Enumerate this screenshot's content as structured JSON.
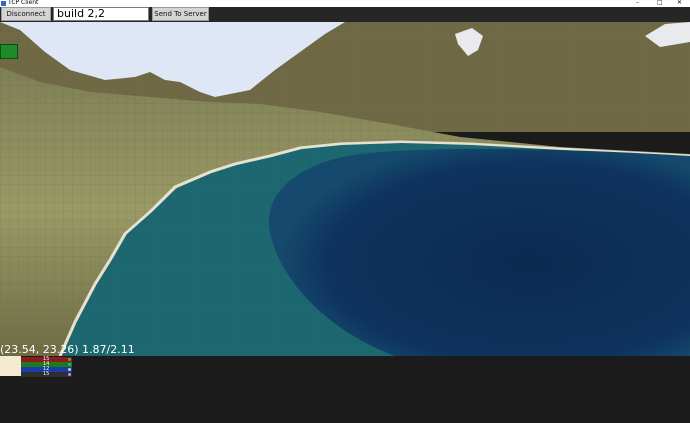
{
  "window": {
    "title": "TCP Client",
    "controls": {
      "minimize": "–",
      "maximize": "□",
      "close": "✕"
    }
  },
  "toolbar": {
    "disconnect_label": "Disconnect",
    "command_value": "build 2,2",
    "send_label": "Send To Server"
  },
  "hud": {
    "coords": "(23.54, 23.26) 1.87/2.11"
  },
  "stats": [
    {
      "value": "15",
      "color": "#8b1a1a",
      "dot_color": "#4caf50"
    },
    {
      "value": "14",
      "color": "#1f7a1f",
      "dot_color": "#4caf50"
    },
    {
      "value": "12",
      "color": "#1c3aa8",
      "dot_color": "#cfcfcf"
    },
    {
      "value": "15",
      "color": "#2e2e2e",
      "dot_color": "#9aa0ff"
    }
  ],
  "colors": {
    "sky": "#dfe6f5",
    "land": "#8b8c5a",
    "shallow_water": "#1e6a73",
    "deep_water": "#0d2d55"
  }
}
